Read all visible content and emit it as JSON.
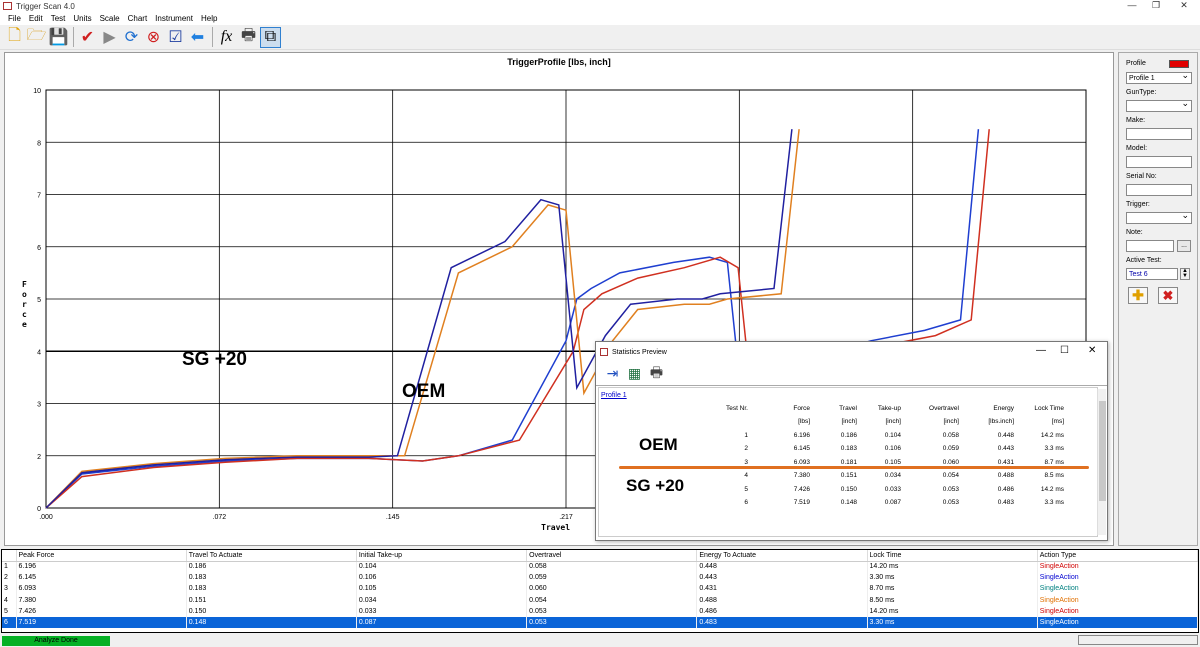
{
  "window": {
    "title": "Trigger Scan 4.0"
  },
  "menu": [
    "File",
    "Edit",
    "Test",
    "Units",
    "Scale",
    "Chart",
    "Instrument",
    "Help"
  ],
  "toolbar_icons": [
    "new-icon",
    "open-icon",
    "save-icon",
    "check-icon",
    "play-icon",
    "refresh-icon",
    "stop-icon",
    "verify-icon",
    "back-arrow-icon",
    "function-icon",
    "print-icon",
    "preview-icon"
  ],
  "chart": {
    "title": "TriggerProfile [lbs, inch]",
    "ylabel": "Force",
    "xlabel": "Travel",
    "yticks": [
      "0",
      "2",
      "3",
      "4",
      "5",
      "6",
      "7",
      "8",
      "10"
    ],
    "xticks": [
      ".000",
      ".072",
      ".145",
      ".217"
    ],
    "annotations": {
      "sg": "SG +20",
      "oem": "OEM"
    }
  },
  "chart_data": {
    "type": "line",
    "title": "TriggerProfile [lbs, inch]",
    "xlabel": "Travel",
    "ylabel": "Force",
    "ylim": [
      0,
      10
    ],
    "xlim": [
      0,
      0.29
    ],
    "grid": true,
    "series": [
      {
        "color": "#1f3fd0",
        "points": [
          [
            0,
            0
          ],
          [
            0.01,
            1.3
          ],
          [
            0.03,
            1.6
          ],
          [
            0.05,
            1.8
          ],
          [
            0.07,
            1.9
          ],
          [
            0.09,
            1.9
          ],
          [
            0.105,
            1.8
          ],
          [
            0.115,
            2.0
          ],
          [
            0.13,
            2.3
          ],
          [
            0.145,
            4.2
          ],
          [
            0.148,
            5.0
          ],
          [
            0.152,
            5.2
          ],
          [
            0.16,
            5.5
          ],
          [
            0.175,
            5.7
          ],
          [
            0.185,
            5.8
          ],
          [
            0.19,
            5.7
          ],
          [
            0.195,
            2.4
          ],
          [
            0.2,
            3.5
          ],
          [
            0.215,
            3.9
          ],
          [
            0.23,
            4.2
          ],
          [
            0.245,
            4.4
          ],
          [
            0.255,
            4.6
          ],
          [
            0.26,
            8.5
          ]
        ]
      },
      {
        "color": "#d03020",
        "points": [
          [
            0,
            0
          ],
          [
            0.01,
            1.2
          ],
          [
            0.03,
            1.55
          ],
          [
            0.05,
            1.75
          ],
          [
            0.07,
            1.9
          ],
          [
            0.09,
            1.9
          ],
          [
            0.105,
            1.8
          ],
          [
            0.115,
            2.0
          ],
          [
            0.132,
            2.3
          ],
          [
            0.147,
            4.0
          ],
          [
            0.15,
            4.8
          ],
          [
            0.155,
            5.1
          ],
          [
            0.165,
            5.4
          ],
          [
            0.178,
            5.6
          ],
          [
            0.188,
            5.8
          ],
          [
            0.193,
            5.6
          ],
          [
            0.198,
            2.3
          ],
          [
            0.203,
            3.4
          ],
          [
            0.218,
            3.8
          ],
          [
            0.233,
            4.1
          ],
          [
            0.248,
            4.3
          ],
          [
            0.258,
            4.6
          ],
          [
            0.263,
            8.5
          ]
        ]
      },
      {
        "color": "#e08020",
        "points": [
          [
            0,
            0
          ],
          [
            0.01,
            1.4
          ],
          [
            0.03,
            1.7
          ],
          [
            0.05,
            1.9
          ],
          [
            0.07,
            2.0
          ],
          [
            0.09,
            2.0
          ],
          [
            0.1,
            2.0
          ],
          [
            0.115,
            5.5
          ],
          [
            0.13,
            6.0
          ],
          [
            0.14,
            6.8
          ],
          [
            0.145,
            6.7
          ],
          [
            0.15,
            3.2
          ],
          [
            0.158,
            4.2
          ],
          [
            0.165,
            4.8
          ],
          [
            0.178,
            4.9
          ],
          [
            0.185,
            4.9
          ],
          [
            0.19,
            5.0
          ],
          [
            0.205,
            5.1
          ],
          [
            0.21,
            8.5
          ]
        ]
      },
      {
        "color": "#2020a0",
        "points": [
          [
            0,
            0
          ],
          [
            0.01,
            1.35
          ],
          [
            0.03,
            1.65
          ],
          [
            0.05,
            1.85
          ],
          [
            0.07,
            1.95
          ],
          [
            0.09,
            1.95
          ],
          [
            0.098,
            2.0
          ],
          [
            0.113,
            5.6
          ],
          [
            0.128,
            6.1
          ],
          [
            0.138,
            6.9
          ],
          [
            0.143,
            6.8
          ],
          [
            0.148,
            3.3
          ],
          [
            0.156,
            4.3
          ],
          [
            0.163,
            4.9
          ],
          [
            0.176,
            5.0
          ],
          [
            0.183,
            5.0
          ],
          [
            0.188,
            5.1
          ],
          [
            0.203,
            5.2
          ],
          [
            0.208,
            8.5
          ]
        ]
      }
    ]
  },
  "right_panel": {
    "profile_label": "Profile",
    "profile_value": "Profile 1",
    "guntype_label": "GunType:",
    "guntype_value": "",
    "make_label": "Make:",
    "make_value": "",
    "model_label": "Model:",
    "model_value": "",
    "serial_label": "Serial No:",
    "serial_value": "",
    "trigger_label": "Trigger:",
    "trigger_value": "",
    "note_label": "Note:",
    "note_value": "",
    "note_btn": "...",
    "active_label": "Active Test:",
    "active_value": "Test 6",
    "accent": "#e00000"
  },
  "stats_window": {
    "title": "Statistics Preview",
    "profile_link": "Profile 1",
    "headers": [
      "Test Nr.",
      "Force",
      "Travel",
      "Take-up",
      "Overtravel",
      "Energy",
      "Lock Time"
    ],
    "units": [
      "",
      "[lbs]",
      "[inch]",
      "[inch]",
      "[inch]",
      "[lbs.inch]",
      "[ms]"
    ],
    "rows": [
      [
        "1",
        "6.196",
        "0.186",
        "0.104",
        "0.058",
        "0.448",
        "14.2 ms"
      ],
      [
        "2",
        "6.145",
        "0.183",
        "0.106",
        "0.059",
        "0.443",
        "3.3 ms"
      ],
      [
        "3",
        "6.093",
        "0.181",
        "0.105",
        "0.060",
        "0.431",
        "8.7 ms"
      ],
      [
        "4",
        "7.380",
        "0.151",
        "0.034",
        "0.054",
        "0.488",
        "8.5 ms"
      ],
      [
        "5",
        "7.426",
        "0.150",
        "0.033",
        "0.053",
        "0.486",
        "14.2 ms"
      ],
      [
        "6",
        "7.519",
        "0.148",
        "0.087",
        "0.053",
        "0.483",
        "3.3 ms"
      ]
    ],
    "oem_label": "OEM",
    "sg_label": "SG +20"
  },
  "results_grid": {
    "headers": [
      "",
      "Peak Force",
      "Travel To Actuate",
      "Initial Take-up",
      "Overtravel",
      "Energy To Actuate",
      "Lock Time",
      "Action Type"
    ],
    "rows": [
      [
        "1",
        "6.196",
        "0.186",
        "0.104",
        "0.058",
        "0.448",
        "14.20 ms",
        "SingleAction"
      ],
      [
        "2",
        "6.145",
        "0.183",
        "0.106",
        "0.059",
        "0.443",
        "3.30 ms",
        "SingleAction"
      ],
      [
        "3",
        "6.093",
        "0.183",
        "0.105",
        "0.060",
        "0.431",
        "8.70 ms",
        "SingleAction"
      ],
      [
        "4",
        "7.380",
        "0.151",
        "0.034",
        "0.054",
        "0.488",
        "8.50 ms",
        "SingleAction"
      ],
      [
        "5",
        "7.426",
        "0.150",
        "0.033",
        "0.053",
        "0.486",
        "14.20 ms",
        "SingleAction"
      ],
      [
        "6",
        "7.519",
        "0.148",
        "0.087",
        "0.053",
        "0.483",
        "3.30 ms",
        "SingleAction"
      ]
    ],
    "action_colors": [
      "#d00000",
      "#0000d0",
      "#008080",
      "#e07000",
      "#d00000",
      "#ffffff"
    ],
    "selected_row": 6
  },
  "status": {
    "text": "Analyze Done"
  }
}
